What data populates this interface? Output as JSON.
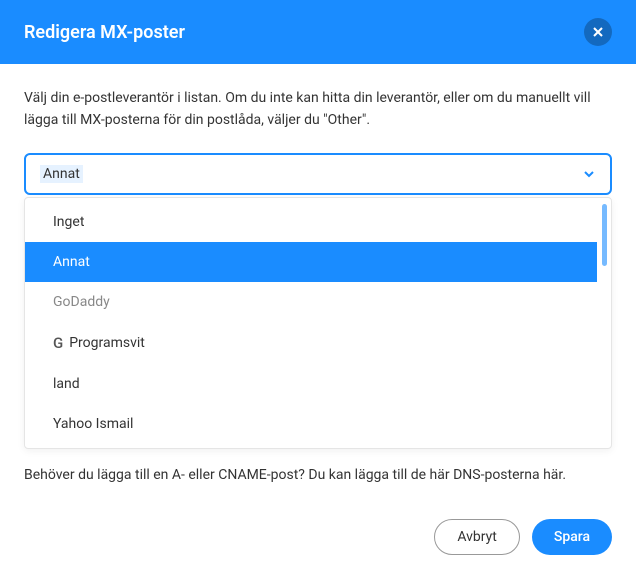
{
  "header": {
    "title": "Redigera MX-poster"
  },
  "body": {
    "description": "Välj din e-postleverantör i listan. Om du inte kan hitta din leverantör, eller om du manuellt vill lägga till MX-posterna för din postlåda, väljer du \"Other\".",
    "select": {
      "value": "Annat",
      "options": [
        {
          "label": "Inget",
          "style": "normal"
        },
        {
          "label": "Annat",
          "style": "selected"
        },
        {
          "label": "GoDaddy",
          "style": "light"
        },
        {
          "label": "Programsvit",
          "style": "with-g"
        },
        {
          "label": "land",
          "style": "normal"
        },
        {
          "label": "Yahoo Ismail",
          "style": "normal"
        }
      ]
    },
    "hint": "Behöver du lägga till en A- eller CNAME-post? Du kan lägga till de här DNS-posterna här."
  },
  "footer": {
    "cancel": "Avbryt",
    "save": "Spara"
  }
}
